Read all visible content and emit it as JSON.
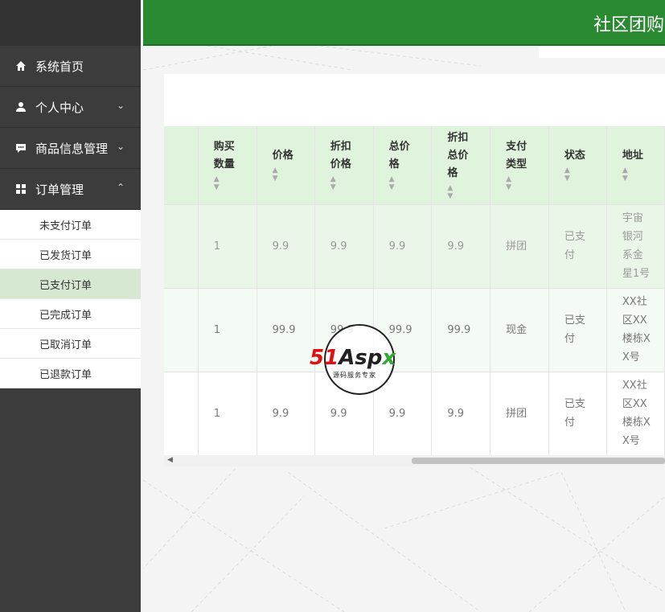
{
  "header": {
    "title": "社区团购"
  },
  "sidebar": {
    "items": [
      {
        "label": "系统首页",
        "icon": "home-icon"
      },
      {
        "label": "个人中心",
        "icon": "user-icon",
        "caret": "chevron-down-icon"
      },
      {
        "label": "商品信息管理",
        "icon": "chat-icon",
        "caret": "chevron-down-icon"
      },
      {
        "label": "订单管理",
        "icon": "grid-icon",
        "caret": "chevron-up-icon"
      }
    ],
    "submenu": [
      {
        "label": "未支付订单"
      },
      {
        "label": "已发货订单"
      },
      {
        "label": "已支付订单",
        "active": true
      },
      {
        "label": "已完成订单"
      },
      {
        "label": "已取消订单"
      },
      {
        "label": "已退款订单"
      }
    ]
  },
  "table": {
    "columns": [
      {
        "label": "",
        "sortable": false
      },
      {
        "label": "购买数量",
        "sortable": true
      },
      {
        "label": "价格",
        "sortable": true
      },
      {
        "label": "折扣价格",
        "sortable": true
      },
      {
        "label": "总价格",
        "sortable": true
      },
      {
        "label": "折扣总价格",
        "sortable": true
      },
      {
        "label": "支付类型",
        "sortable": true
      },
      {
        "label": "状态",
        "sortable": true
      },
      {
        "label": "地址",
        "sortable": true
      }
    ],
    "rows": [
      [
        "",
        "1",
        "9.9",
        "9.9",
        "9.9",
        "9.9",
        "拼团",
        "已支付",
        "宇宙银河系金星1号"
      ],
      [
        "",
        "1",
        "99.9",
        "99.9",
        "99.9",
        "99.9",
        "现金",
        "已支付",
        "XX社区XX楼栋XX号"
      ],
      [
        "",
        "1",
        "9.9",
        "9.9",
        "9.9",
        "9.9",
        "拼团",
        "已支付",
        "XX社区XX楼栋XX号"
      ]
    ]
  },
  "watermark": {
    "logo_a": "51",
    "logo_b": "Asp",
    "logo_c": "x",
    "subtitle": "源码服务专家"
  },
  "colors": {
    "header": "#2a8a32",
    "sidebar": "#3c3c3c",
    "active_submenu": "#d7e8d2",
    "table_head": "#e0f3dc"
  }
}
